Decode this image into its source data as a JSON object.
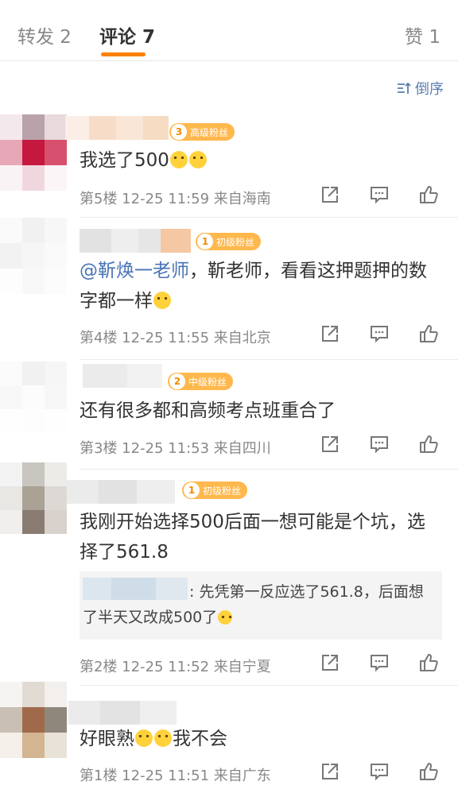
{
  "tabs": {
    "repost": "转发 2",
    "comments": "评论 7",
    "likes": "赞 1"
  },
  "sort_label": "倒序",
  "comments": [
    {
      "badge_level": "3",
      "badge_text": "高级粉丝",
      "text": "我选了500",
      "meta": "第5楼  12-25 11:59  来自海南"
    },
    {
      "badge_level": "1",
      "badge_text": "初级粉丝",
      "mention": "@靳焕一老师",
      "text": "，靳老师，看看这押题押的数字都一样",
      "meta": "第4楼  12-25 11:55  来自北京"
    },
    {
      "badge_level": "2",
      "badge_text": "中级粉丝",
      "text": "还有很多都和高频考点班重合了",
      "meta": "第3楼  12-25 11:53  来自四川"
    },
    {
      "badge_level": "1",
      "badge_text": "初级粉丝",
      "text": "我刚开始选择500后面一想可能是个坑，选择了561.8",
      "reply": ": 先凭第一反应选了561.8，后面想了半天又改成500了",
      "meta": "第2楼  12-25 11:52  来自宁夏"
    },
    {
      "text_a": "好眼熟",
      "text_b": "我不会",
      "meta": "第1楼  12-25 11:51  来自广东"
    }
  ],
  "icons": [
    "share-icon",
    "comment-icon",
    "like-icon",
    "sort-icon"
  ],
  "colors": {
    "accent": "#ff8200",
    "link": "#4a74b5",
    "badge": "#ffb84d"
  }
}
